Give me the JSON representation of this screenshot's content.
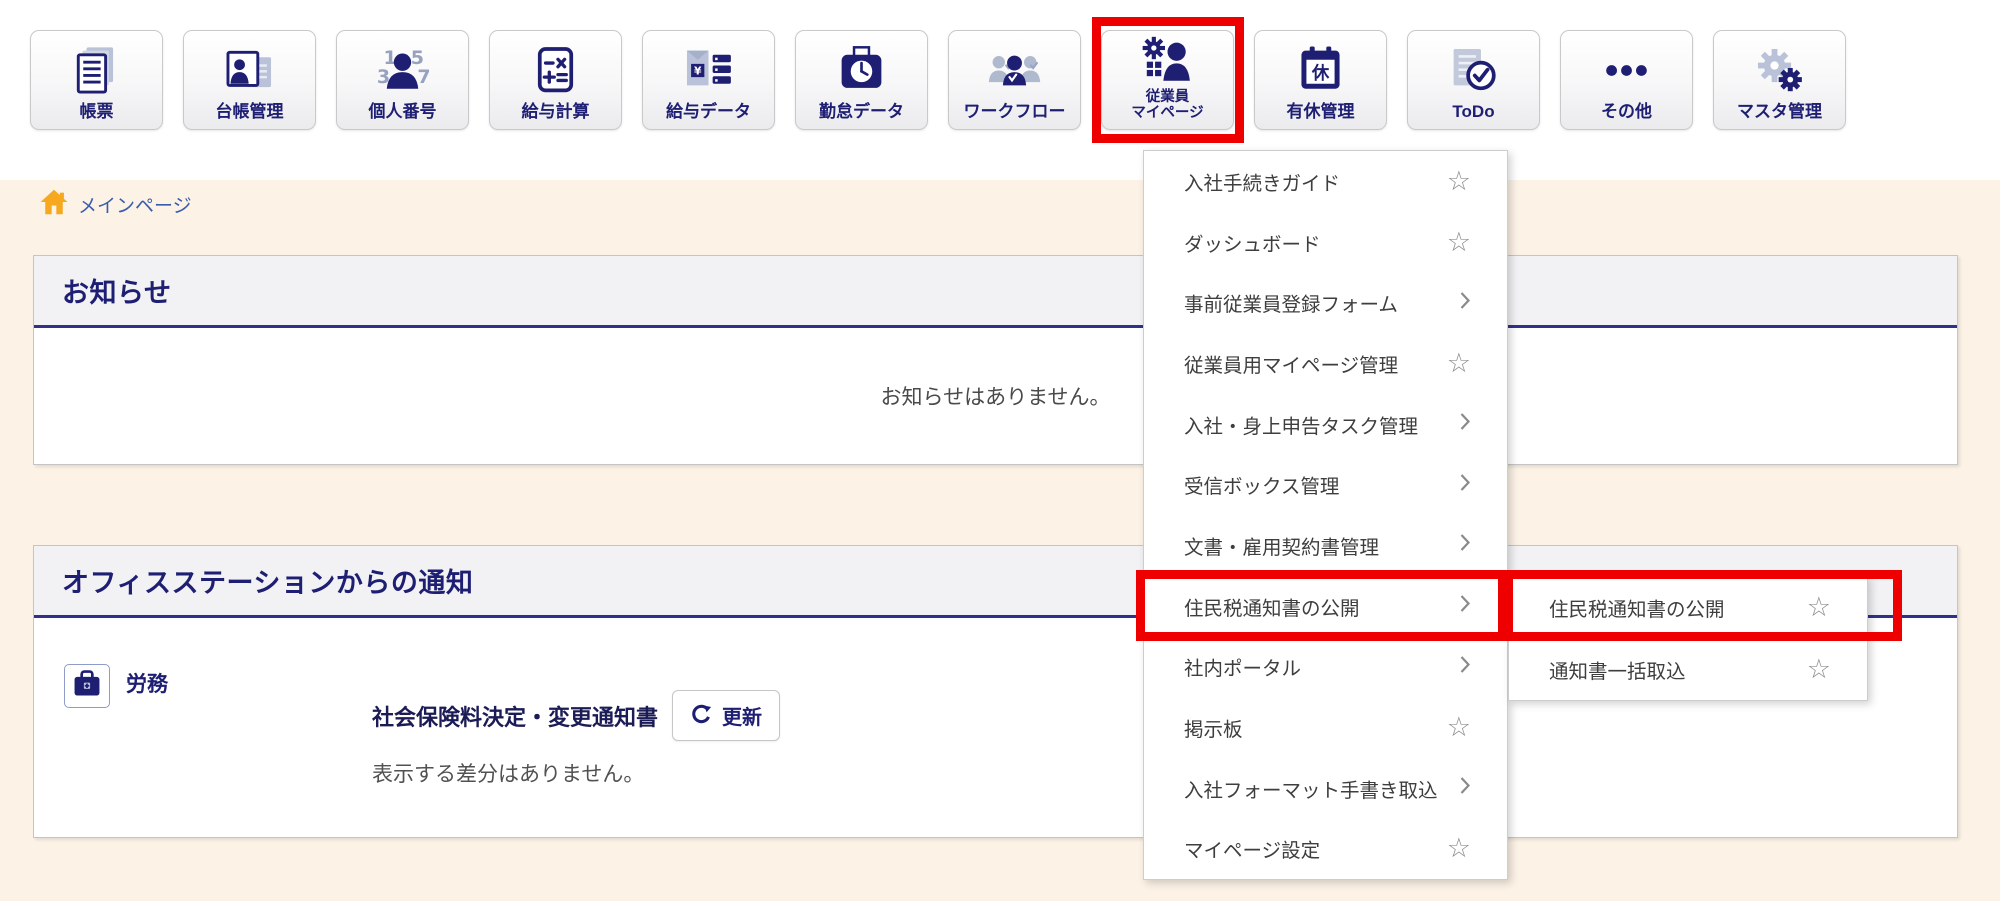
{
  "colors": {
    "navy": "#1e1e73",
    "icon_accent": "#b9c2d8",
    "highlight_red": "#ee0000",
    "page_background": "#fcf2e6",
    "breadcrumb_blue": "#3a5cad",
    "home_orange": "#f6a81f",
    "header_strip": "#f2f2f5",
    "header_rule": "#31318a"
  },
  "icons": {
    "star": "☆"
  },
  "toolbar": {
    "buttons": [
      {
        "label": "帳票",
        "icon": "documents-icon"
      },
      {
        "label": "台帳管理",
        "icon": "ledger-icon"
      },
      {
        "label": "個人番号",
        "icon": "mynumber-icon"
      },
      {
        "label": "給与計算",
        "icon": "calculator-icon"
      },
      {
        "label": "給与データ",
        "icon": "payroll-data-icon"
      },
      {
        "label": "勤怠データ",
        "icon": "attendance-icon"
      },
      {
        "label": "ワークフロー",
        "icon": "workflow-icon"
      },
      {
        "label": "従業員マイページ",
        "label_lines": [
          "従業員",
          "マイページ"
        ],
        "icon": "employee-mypage-icon",
        "highlighted": true
      },
      {
        "label": "有休管理",
        "icon": "paid-leave-icon"
      },
      {
        "label": "ToDo",
        "icon": "todo-icon"
      },
      {
        "label": "その他",
        "icon": "more-icon"
      },
      {
        "label": "マスタ管理",
        "icon": "master-icon"
      }
    ]
  },
  "breadcrumb": {
    "label": "メインページ"
  },
  "notice_section": {
    "title": "お知らせ",
    "empty_message": "お知らせはありません。"
  },
  "notification_section": {
    "title": "オフィスステーションからの通知",
    "category": "労務",
    "item_title": "社会保険料決定・変更通知書",
    "refresh_button": "更新",
    "status_message": "表示する差分はありません。"
  },
  "employee_menu": {
    "items": [
      {
        "label": "入社手続きガイド",
        "trailing": "star"
      },
      {
        "label": "ダッシュボード",
        "trailing": "star"
      },
      {
        "label": "事前従業員登録フォーム",
        "trailing": "chevron"
      },
      {
        "label": "従業員用マイページ管理",
        "trailing": "star"
      },
      {
        "label": "入社・身上申告タスク管理",
        "trailing": "chevron"
      },
      {
        "label": "受信ボックス管理",
        "trailing": "chevron"
      },
      {
        "label": "文書・雇用契約書管理",
        "trailing": "chevron"
      },
      {
        "label": "住民税通知書の公開",
        "trailing": "chevron",
        "highlighted": true
      },
      {
        "label": "社内ポータル",
        "trailing": "chevron"
      },
      {
        "label": "掲示板",
        "trailing": "star"
      },
      {
        "label": "入社フォーマット手書き取込",
        "trailing": "chevron"
      },
      {
        "label": "マイページ設定",
        "trailing": "star"
      }
    ]
  },
  "submenu": {
    "items": [
      {
        "label": "住民税通知書の公開",
        "trailing": "star",
        "highlighted": true
      },
      {
        "label": "通知書一括取込",
        "trailing": "star"
      }
    ]
  }
}
